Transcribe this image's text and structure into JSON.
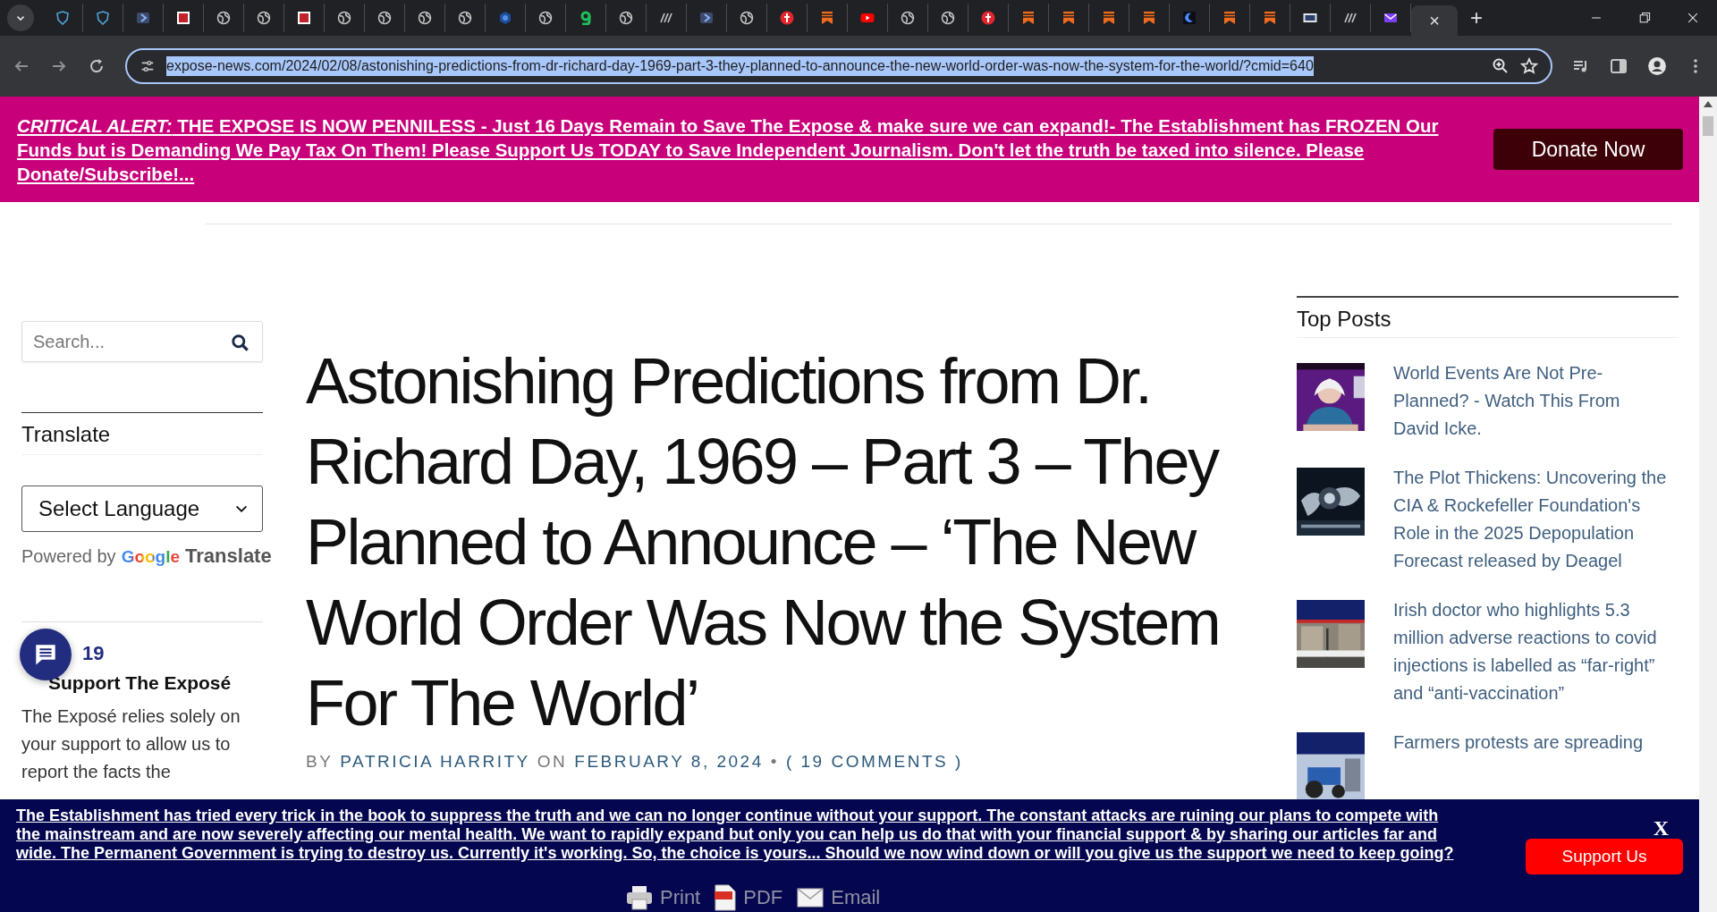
{
  "browser": {
    "tabs": [
      {
        "selected": false
      },
      {
        "selected": false
      },
      {
        "selected": false
      },
      {
        "selected": false
      },
      {
        "selected": false
      },
      {
        "selected": false
      },
      {
        "selected": false
      },
      {
        "selected": false
      },
      {
        "selected": false
      },
      {
        "selected": false
      },
      {
        "selected": false
      },
      {
        "selected": false
      },
      {
        "selected": false
      },
      {
        "selected": false
      },
      {
        "selected": false
      },
      {
        "selected": false
      },
      {
        "selected": false
      },
      {
        "selected": false
      },
      {
        "selected": false
      },
      {
        "selected": false
      },
      {
        "selected": false
      },
      {
        "selected": false
      },
      {
        "selected": false
      },
      {
        "selected": false
      },
      {
        "selected": false
      },
      {
        "selected": false
      },
      {
        "selected": false
      },
      {
        "selected": false
      },
      {
        "selected": false
      },
      {
        "selected": false
      },
      {
        "selected": false
      },
      {
        "selected": false
      },
      {
        "selected": false
      },
      {
        "selected": false
      },
      {
        "selected": true,
        "close": "×"
      }
    ],
    "new_tab": "+",
    "url": "expose-news.com/2024/02/08/astonishing-predictions-from-dr-richard-day-1969-part-3-they-planned-to-announce-the-new-world-order-was-now-the-system-for-the-world/?cmid=640"
  },
  "alert_banner": {
    "text": "*CRITICAL ALERT:* THE EXPOSE IS NOW PENNILESS - Just 16 Days Remain to Save The Expose & make sure we can expand!- The Establishment has FROZEN Our Funds but is Demanding We Pay Tax On Them! Please Support Us TODAY to Save Independent Journalism. Don't let the truth be taxed into silence. Please Donate/Subscribe!...",
    "button": "Donate Now"
  },
  "left_sidebar": {
    "search": {
      "placeholder": "Search..."
    },
    "translate": {
      "heading": "Translate",
      "select": "Select Language",
      "powered_by": "Powered by",
      "google": "Google",
      "service": "Translate"
    },
    "support": {
      "heading": "Support The Exposé",
      "text": "The Exposé relies solely on your support to allow us to report the facts the"
    },
    "chat": {
      "badge": "19"
    }
  },
  "article": {
    "title": "Astonishing Predictions from Dr. Richard Day, 1969 – Part 3 – They Planned to Announce – ‘The New World Order Was Now the System For The World’",
    "byline": {
      "prefix": "BY",
      "author": "PATRICIA HARRITY",
      "on": "ON",
      "date": "FEBRUARY 8, 2024",
      "separator": "•",
      "comments": "( 19 COMMENTS )"
    }
  },
  "right_sidebar": {
    "heading": "Top Posts",
    "posts": [
      {
        "title": "World Events Are Not Pre-Planned? - Watch This From David Icke."
      },
      {
        "title": "The Plot Thickens: Uncovering the CIA & Rockefeller Foundation's Role in the 2025 Depopulation Forecast released by Deagel"
      },
      {
        "title": "Irish doctor who highlights 5.3 million adverse reactions to covid injections is labelled as “far-right” and “anti-vaccination”"
      },
      {
        "title": "Farmers protests are spreading"
      }
    ]
  },
  "share_bar": [
    "Print",
    "PDF",
    "Email"
  ],
  "support_banner": {
    "text": "The Establishment has tried every trick in the book to suppress the truth and we can no longer continue without your support. The constant attacks are ruining our plans to compete with the mainstream and are now severely affecting our mental health. We want to rapidly expand but only you can help us do that with your financial support & by sharing our articles far and wide. The Permanent Government is trying to destroy us. Currently it's working. So, the choice is yours... Should we now wind down or will you give us the support we need to keep going?",
    "close": "X",
    "button": "Support Us"
  }
}
